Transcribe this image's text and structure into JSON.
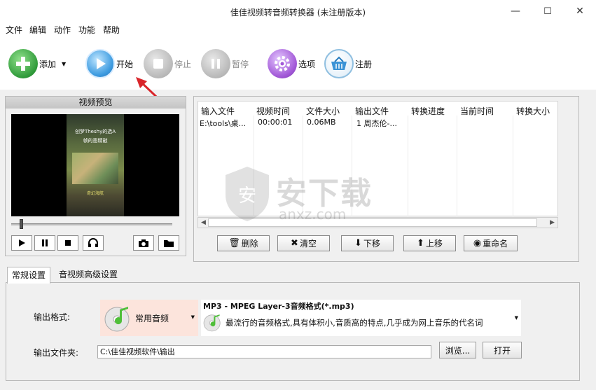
{
  "window": {
    "title": "佳佳视频转音频转换器 (未注册版本)",
    "minimize_glyph": "—",
    "maximize_glyph": "☐",
    "close_glyph": "✕"
  },
  "menu": [
    "文件",
    "编辑",
    "动作",
    "功能",
    "帮助"
  ],
  "toolbar": {
    "add": "添加",
    "start": "开始",
    "stop": "停止",
    "pause": "暂停",
    "options": "选项",
    "register": "注册"
  },
  "preview": {
    "header": "视频预览",
    "overlay_top": "创梦Theshy的选A",
    "overlay_sub": "帧的悲精敲",
    "overlay_bottom": "奇幻海航",
    "playback_fraction": 0.05
  },
  "file_list": {
    "columns": [
      "输入文件",
      "视频时间",
      "文件大小",
      "输出文件",
      "转换进度",
      "当前时间",
      "转换大小"
    ],
    "rows": [
      [
        "E:\\tools\\桌...",
        "00:00:01",
        "0.06MB",
        "1 周杰伦-...",
        "",
        "",
        ""
      ]
    ]
  },
  "actions": {
    "delete": "删除",
    "clear": "清空",
    "move_down": "下移",
    "move_up": "上移",
    "rename": "重命名"
  },
  "tabs": [
    "常规设置",
    "音视频高级设置"
  ],
  "settings": {
    "output_format_label": "输出格式:",
    "format_category": "常用音频",
    "format_name": "MP3 - MPEG Layer-3音频格式(*.mp3)",
    "format_desc": "最流行的音频格式,具有体积小,音质高的特点,几乎成为网上音乐的代名词",
    "output_folder_label": "输出文件夹:",
    "output_folder": "C:\\佳佳视频软件\\输出",
    "browse": "浏览...",
    "open": "打开"
  },
  "watermark": {
    "text": "安下载",
    "subtext": "anxz.com"
  }
}
